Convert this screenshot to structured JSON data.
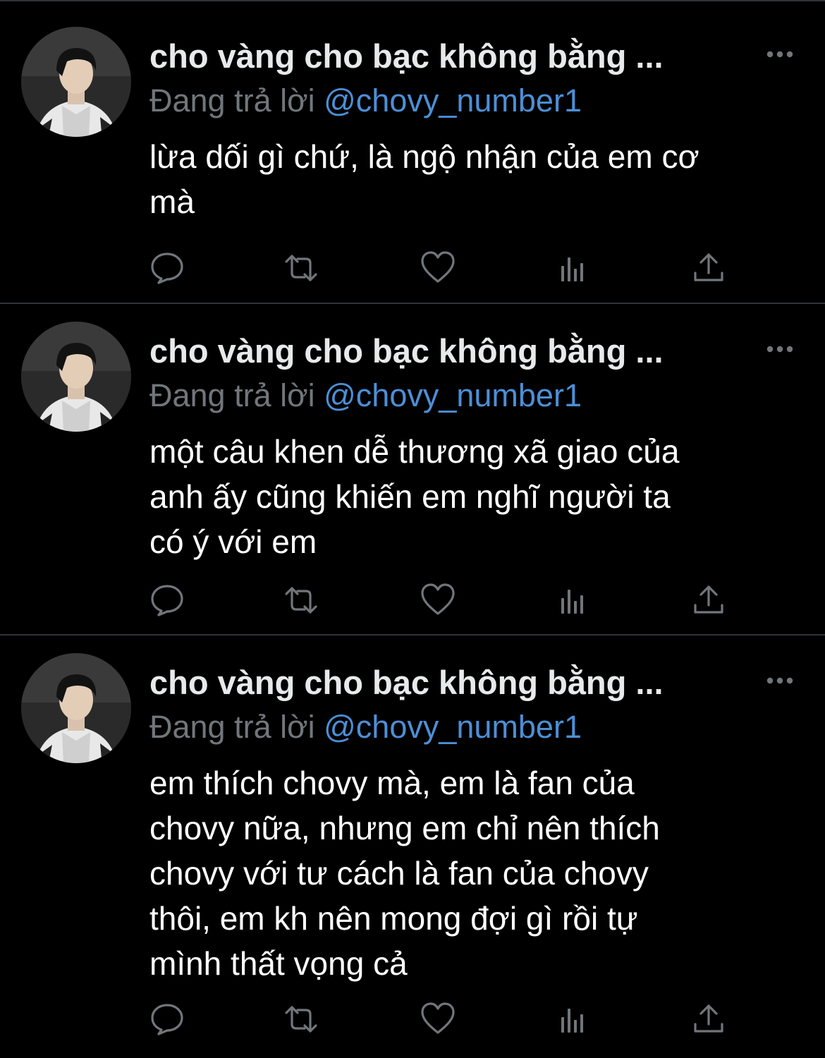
{
  "tweets": [
    {
      "display_name": "cho vàng cho bạc không bằng ...",
      "reply_prefix": "Đang trả lời ",
      "reply_handle": "@chovy_number1",
      "text": "lừa dối gì chứ, là ngộ nhận của em cơ\nmà"
    },
    {
      "display_name": "cho vàng cho bạc không bằng ...",
      "reply_prefix": "Đang trả lời ",
      "reply_handle": "@chovy_number1",
      "text": "một câu khen dễ thương xã giao của\nanh ấy cũng khiến em nghĩ người ta\ncó ý với em"
    },
    {
      "display_name": "cho vàng cho bạc không bằng ...",
      "reply_prefix": "Đang trả lời ",
      "reply_handle": "@chovy_number1",
      "text": "em thích chovy mà, em là fan của\nchovy nữa, nhưng em chỉ nên thích\nchovy với tư cách là fan của chovy\nthôi, em kh nên mong đợi gì rồi tự\nmình thất vọng cả"
    }
  ],
  "icons": {
    "more": "more-horizontal-icon",
    "reply": "reply-bubble-icon",
    "retweet": "retweet-icon",
    "like": "heart-icon",
    "views": "views-bar-chart-icon",
    "share": "share-upload-icon"
  },
  "colors": {
    "background": "#000000",
    "text": "#ffffff",
    "muted": "#71767b",
    "link": "#4c8fd6",
    "divider": "#2f3336"
  }
}
